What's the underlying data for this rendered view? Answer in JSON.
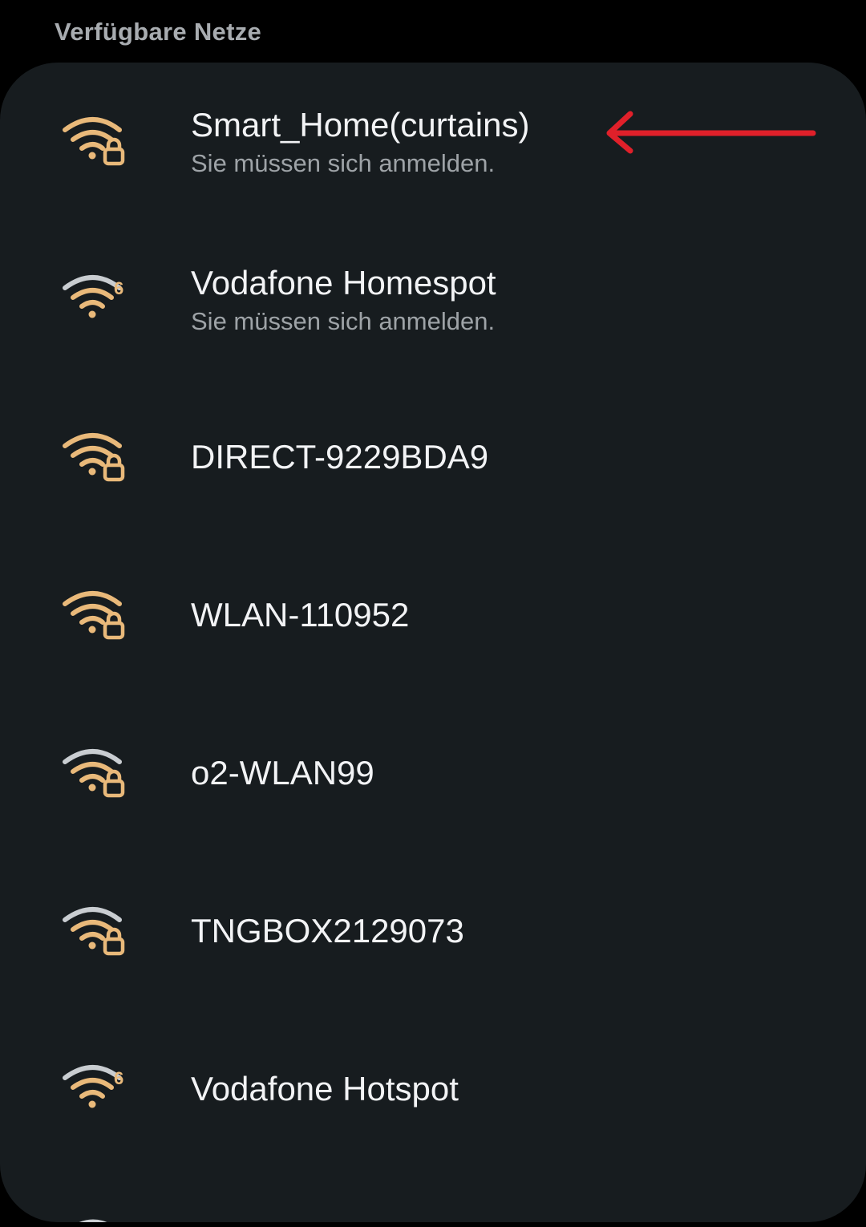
{
  "section_title": "Verfügbare Netze",
  "colors": {
    "background": "#000000",
    "card": "#171c1f",
    "wifi_active": "#e9b97a",
    "wifi_inactive": "#c9cdd1",
    "annotation_arrow": "#e0202a"
  },
  "networks": [
    {
      "name": "Smart_Home(curtains)",
      "subtitle": "Sie müssen sich anmelden.",
      "icon": "wifi-lock-icon",
      "signal_bars": 3
    },
    {
      "name": "Vodafone Homespot",
      "subtitle": "Sie müssen sich anmelden.",
      "icon": "wifi-6-icon",
      "signal_bars": 3
    },
    {
      "name": "DIRECT-9229BDA9",
      "subtitle": "",
      "icon": "wifi-lock-icon",
      "signal_bars": 3
    },
    {
      "name": "WLAN-110952",
      "subtitle": "",
      "icon": "wifi-lock-icon",
      "signal_bars": 3
    },
    {
      "name": "o2-WLAN99",
      "subtitle": "",
      "icon": "wifi-lock-icon",
      "signal_bars": 2
    },
    {
      "name": "TNGBOX2129073",
      "subtitle": "",
      "icon": "wifi-lock-icon",
      "signal_bars": 2
    },
    {
      "name": "Vodafone Hotspot",
      "subtitle": "",
      "icon": "wifi-6-icon",
      "signal_bars": 3
    }
  ],
  "wifi6_badge": "6",
  "annotation": {
    "type": "arrow",
    "points_to": "Smart_Home(curtains)"
  }
}
